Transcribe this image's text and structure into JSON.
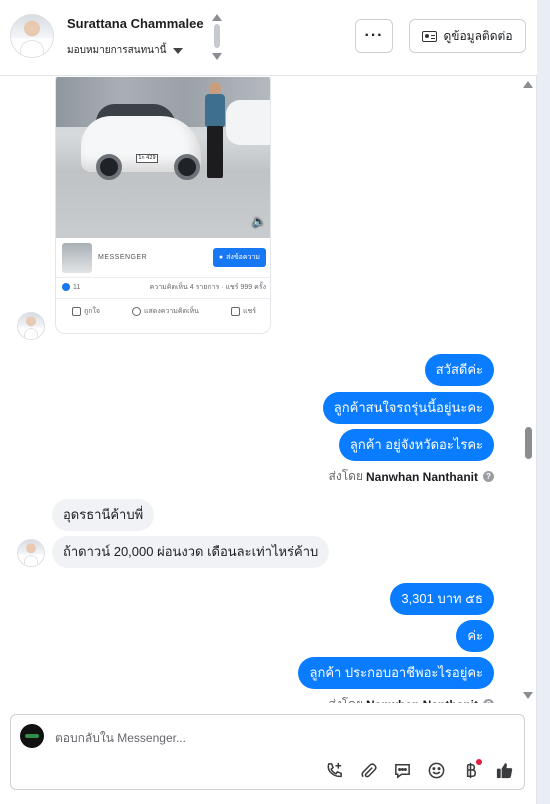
{
  "header": {
    "name": "Surattana Chammalee",
    "assign_label": "มอบหมายการสนทนานี้",
    "more_label": "···",
    "contact_label": "ดูข้อมูลติดต่อ"
  },
  "shared_post": {
    "plate": "1ก 429",
    "source_name": "MESSENGER",
    "send_label": "ส่งข้อความ",
    "likes": "11",
    "stats": "ความคิดเห็น 4 รายการ · แชร์ 999 ครั้ง",
    "action_like": "ถูกใจ",
    "action_comment": "แสดงความคิดเห็น",
    "action_share": "แชร์"
  },
  "messages_out_1": [
    "สวัสดีค่ะ",
    "ลูกค้าสนใจรถรุ่นนี้อยู่นะคะ",
    "ลูกค้า อยู่จังหวัดอะไรคะ"
  ],
  "sent_by_prefix": "ส่งโดย",
  "sent_by_name": "Nanwhan Nanthanit",
  "messages_in": [
    "อุดรธานีค้าบพี่",
    "ถ้าดาวน์ 20,000 ผ่อนงวด เดือนละเท่าไหร่ค้าบ"
  ],
  "messages_out_2": [
    "3,301 บาท ๕ธ",
    "ค่ะ",
    "ลูกค้า ประกอบอาชีพอะไรอยู่คะ"
  ],
  "composer": {
    "placeholder": "ตอบกลับใน Messenger..."
  },
  "colors": {
    "outgoing_bubble": "#0a7cff",
    "incoming_bubble": "#f0f2f5",
    "notification_dot": "#e41e3f"
  },
  "icons": [
    "phone-plus-icon",
    "paperclip-icon",
    "saved-reply-icon",
    "emoji-icon",
    "baht-icon",
    "thumbs-up-icon"
  ]
}
